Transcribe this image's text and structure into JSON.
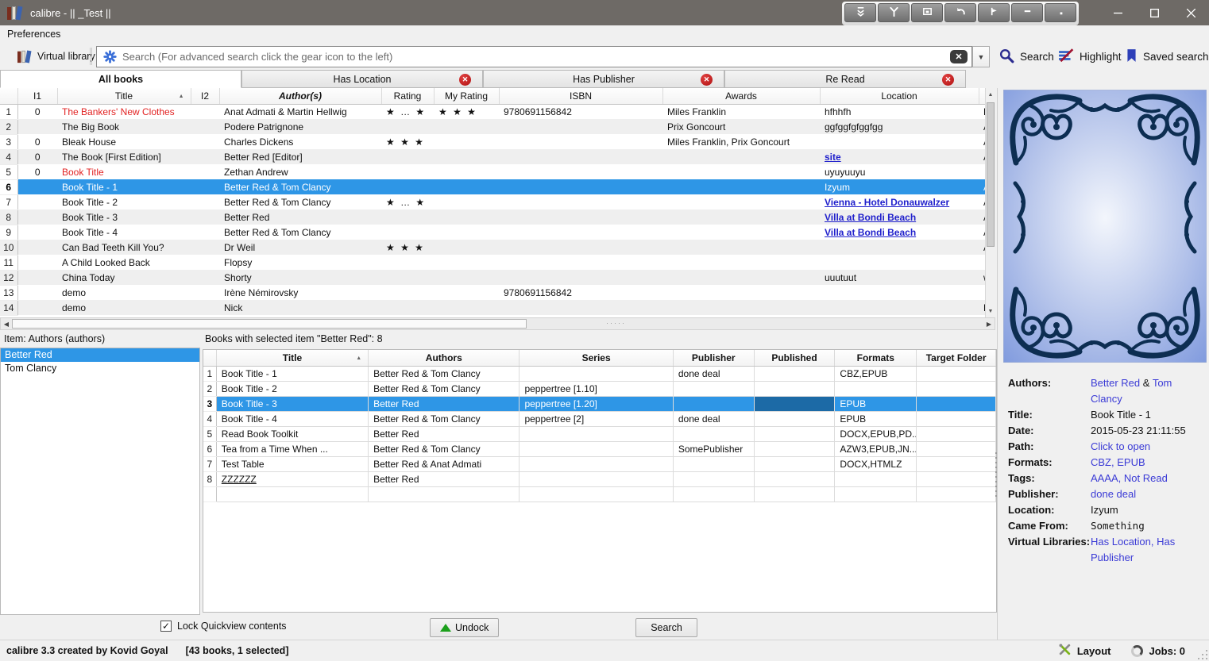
{
  "window": {
    "title": "calibre - || _Test ||"
  },
  "titlebar": {
    "buttons": [
      {
        "icon": "chevrons-down-icon"
      },
      {
        "icon": "wrench-icon"
      },
      {
        "icon": "window-icon"
      },
      {
        "icon": "undo-arrow-icon"
      },
      {
        "icon": "marker-flag-icon"
      },
      {
        "icon": "dash-icon"
      },
      {
        "icon": "dot-icon"
      }
    ],
    "controls": [
      "minimize",
      "maximize",
      "close"
    ]
  },
  "menubar": {
    "items": [
      "Preferences"
    ]
  },
  "toolbar": {
    "virtual_library": "Virtual library",
    "search_placeholder": "Search (For advanced search click the gear icon to the left)",
    "search_label": "Search",
    "highlight_label": "Highlight",
    "saved_search_label": "Saved search"
  },
  "tabs": [
    {
      "label": "All books",
      "active": true,
      "closable": false
    },
    {
      "label": "Has Location",
      "active": false,
      "closable": true
    },
    {
      "label": "Has Publisher",
      "active": false,
      "closable": true
    },
    {
      "label": "Re Read",
      "active": false,
      "closable": true
    }
  ],
  "library_table": {
    "headers": [
      "",
      "I1",
      "Title",
      "I2",
      "Author(s)",
      "Rating",
      "My Rating",
      "ISBN",
      "Awards",
      "Location",
      ""
    ],
    "sort_column": "Title",
    "rows": [
      {
        "n": "1",
        "i1": "0",
        "title": "The Bankers' New Clothes",
        "red": true,
        "authors": "Anat Admati & Martin Hellwig",
        "rating": "★ … ★",
        "my_rating": "★ ★ ★",
        "isbn": "9780691156842",
        "awards": "Miles Franklin",
        "location": "hfhhfh",
        "loc_link": false,
        "sel": false,
        "extra": "B"
      },
      {
        "n": "2",
        "i1": "",
        "title": "The Big Book",
        "red": false,
        "authors": "Podere Patrignone",
        "rating": "",
        "my_rating": "",
        "isbn": "",
        "awards": "Prix Goncourt",
        "location": "ggfggfgfggfgg",
        "loc_link": false,
        "sel": false,
        "extra": "A"
      },
      {
        "n": "3",
        "i1": "0",
        "title": "Bleak House",
        "red": false,
        "authors": "Charles Dickens",
        "rating": "★ ★ ★",
        "my_rating": "",
        "isbn": "",
        "awards": "Miles Franklin, Prix Goncourt",
        "location": "",
        "loc_link": false,
        "sel": false,
        "extra": "A"
      },
      {
        "n": "4",
        "i1": "0",
        "title": "The Book [First Edition]",
        "red": false,
        "authors": "Better Red [Editor]",
        "rating": "",
        "my_rating": "",
        "isbn": "",
        "awards": "",
        "location": "site",
        "loc_link": true,
        "sel": false,
        "extra": "A"
      },
      {
        "n": "5",
        "i1": "0",
        "title": "Book Title",
        "red": true,
        "authors": "Zethan Andrew",
        "rating": "",
        "my_rating": "",
        "isbn": "",
        "awards": "",
        "location": "uyuyuuyu",
        "loc_link": false,
        "sel": false,
        "extra": ""
      },
      {
        "n": "6",
        "i1": "",
        "title": "Book Title -  1",
        "red": false,
        "authors": "Better Red & Tom Clancy",
        "rating": "",
        "my_rating": "",
        "isbn": "",
        "awards": "",
        "location": "Izyum",
        "loc_link": false,
        "sel": true,
        "extra": "A"
      },
      {
        "n": "7",
        "i1": "",
        "title": "Book Title -  2",
        "red": false,
        "authors": "Better Red & Tom Clancy",
        "rating": "★ … ★",
        "my_rating": "",
        "isbn": "",
        "awards": "",
        "location": "Vienna - Hotel Donauwalzer",
        "loc_link": true,
        "sel": false,
        "extra": "A"
      },
      {
        "n": "8",
        "i1": "",
        "title": "Book Title -  3",
        "red": false,
        "authors": "Better Red",
        "rating": "",
        "my_rating": "",
        "isbn": "",
        "awards": "",
        "location": "Villa at Bondi Beach",
        "loc_link": true,
        "sel": false,
        "extra": "A"
      },
      {
        "n": "9",
        "i1": "",
        "title": "Book Title -  4",
        "red": false,
        "authors": "Better Red & Tom Clancy",
        "rating": "",
        "my_rating": "",
        "isbn": "",
        "awards": "",
        "location": "Villa at Bondi Beach",
        "loc_link": true,
        "sel": false,
        "extra": "A"
      },
      {
        "n": "10",
        "i1": "",
        "title": "Can Bad Teeth Kill You?",
        "red": false,
        "authors": "Dr Weil",
        "rating": "★ ★ ★",
        "my_rating": "",
        "isbn": "",
        "awards": "",
        "location": "",
        "loc_link": false,
        "sel": false,
        "extra": "A"
      },
      {
        "n": "11",
        "i1": "",
        "title": "A Child Looked Back",
        "red": false,
        "authors": "Flopsy",
        "rating": "",
        "my_rating": "",
        "isbn": "",
        "awards": "",
        "location": "",
        "loc_link": false,
        "sel": false,
        "extra": ""
      },
      {
        "n": "12",
        "i1": "",
        "title": "China Today",
        "red": false,
        "authors": "Shorty",
        "rating": "",
        "my_rating": "",
        "isbn": "",
        "awards": "",
        "location": "uuutuut",
        "loc_link": false,
        "sel": false,
        "extra": "w"
      },
      {
        "n": "13",
        "i1": "",
        "title": "demo",
        "red": false,
        "authors": "Irène Némirovsky",
        "rating": "",
        "my_rating": "",
        "isbn": "9780691156842",
        "awards": "",
        "location": "",
        "loc_link": false,
        "sel": false,
        "extra": ""
      },
      {
        "n": "14",
        "i1": "",
        "title": "demo",
        "red": false,
        "authors": "Nick",
        "rating": "",
        "my_rating": "",
        "isbn": "",
        "awards": "",
        "location": "",
        "loc_link": false,
        "sel": false,
        "extra": "B"
      }
    ]
  },
  "quickview": {
    "item_label": "Item: Authors (authors)",
    "items": [
      {
        "label": "Better Red",
        "selected": true
      },
      {
        "label": "Tom Clancy",
        "selected": false
      }
    ],
    "books_label": "Books with selected item \"Better Red\": 8",
    "headers": [
      "",
      "Title",
      "Authors",
      "Series",
      "Publisher",
      "Published",
      "Formats",
      "Target Folder"
    ],
    "sort_column": "Title",
    "rows": [
      {
        "n": "1",
        "title": "Book Title -  1",
        "u": false,
        "authors": "Better Red & Tom Clancy",
        "series": "",
        "publisher": "done deal",
        "published": "",
        "formats": "CBZ,EPUB",
        "target": "",
        "sel": false
      },
      {
        "n": "2",
        "title": "Book Title -  2",
        "u": false,
        "authors": "Better Red & Tom Clancy",
        "series": "peppertree [1.10]",
        "publisher": "",
        "published": "",
        "formats": "",
        "target": "",
        "sel": false
      },
      {
        "n": "3",
        "title": "Book Title -  3",
        "u": false,
        "authors": "Better Red",
        "series": "peppertree [1.20]",
        "publisher": "",
        "published": "",
        "formats": "EPUB",
        "target": "",
        "sel": true
      },
      {
        "n": "4",
        "title": "Book Title -  4",
        "u": false,
        "authors": "Better Red & Tom Clancy",
        "series": "peppertree [2]",
        "publisher": "done deal",
        "published": "",
        "formats": "EPUB",
        "target": "",
        "sel": false
      },
      {
        "n": "5",
        "title": "Read Book Toolkit",
        "u": false,
        "authors": "Better Red",
        "series": "",
        "publisher": "",
        "published": "",
        "formats": "DOCX,EPUB,PD...",
        "target": "",
        "sel": false
      },
      {
        "n": "6",
        "title": "Tea from a Time When ...",
        "u": false,
        "authors": "Better Red & Tom Clancy",
        "series": "",
        "publisher": "SomePublisher",
        "published": "",
        "formats": "AZW3,EPUB,JN...",
        "target": "",
        "sel": false
      },
      {
        "n": "7",
        "title": "Test Table",
        "u": false,
        "authors": "Better Red & Anat Admati",
        "series": "",
        "publisher": "",
        "published": "",
        "formats": "DOCX,HTMLZ",
        "target": "",
        "sel": false
      },
      {
        "n": "8",
        "title": "ZZZZZZ",
        "u": true,
        "authors": "Better Red",
        "series": "",
        "publisher": "",
        "published": "",
        "formats": "",
        "target": "",
        "sel": false
      }
    ]
  },
  "book_details": {
    "fields": [
      {
        "label": "Authors:",
        "parts": [
          {
            "t": "Better Red",
            "link": true
          },
          {
            "t": " & "
          },
          {
            "t": "Tom Clancy",
            "link": true
          }
        ]
      },
      {
        "label": "Title:",
        "parts": [
          {
            "t": "Book Title - 1"
          }
        ]
      },
      {
        "label": "Date:",
        "parts": [
          {
            "t": "2015-05-23 21:11:55"
          }
        ]
      },
      {
        "label": "Path:",
        "parts": [
          {
            "t": "Click to open",
            "link": true
          }
        ]
      },
      {
        "label": "Formats:",
        "parts": [
          {
            "t": "CBZ, EPUB",
            "link": true
          }
        ]
      },
      {
        "label": "Tags:",
        "parts": [
          {
            "t": "AAAA, Not Read",
            "link": true
          }
        ]
      },
      {
        "label": "Publisher:",
        "parts": [
          {
            "t": "done deal",
            "link": true
          }
        ]
      },
      {
        "label": "Location:",
        "parts": [
          {
            "t": "Izyum"
          }
        ]
      },
      {
        "label": "Came From:",
        "parts": [
          {
            "t": "Something",
            "mono": true
          }
        ]
      },
      {
        "label": "Virtual Libraries:",
        "parts": [
          {
            "t": "Has Location, Has Publisher",
            "link": true
          }
        ]
      }
    ]
  },
  "footer": {
    "lock_label": "Lock Quickview contents",
    "lock_checked": true,
    "undock_label": "Undock",
    "search_label": "Search"
  },
  "statusbar": {
    "left": "calibre 3.3 created by Kovid Goyal",
    "books": "[43 books, 1 selected]",
    "layout_label": "Layout",
    "jobs_label": "Jobs: 0"
  },
  "colors": {
    "selection": "#2e96e6",
    "selection_focused_cell": "#1c6aa6",
    "table_link": "#2121cc",
    "details_link": "#3b3bd6",
    "red_title": "#e22222",
    "tab_close": "#b01212",
    "titlebar": "#6e6a66",
    "cover_frame": "#0d2e52",
    "cover_background": "#8aa2e0"
  }
}
